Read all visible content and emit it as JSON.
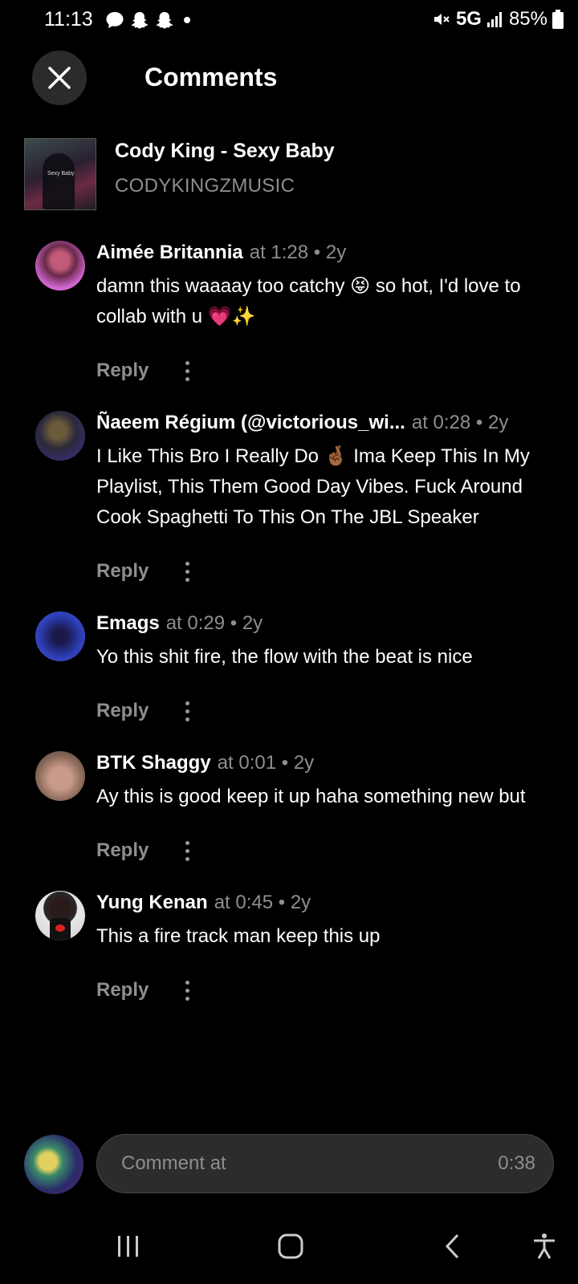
{
  "status_bar": {
    "time": "11:13",
    "network": "5G",
    "battery": "85%"
  },
  "header": {
    "title": "Comments"
  },
  "track": {
    "title": "Cody King - Sexy Baby",
    "artist": "CODYKINGZMUSIC",
    "cover_text": "Sexy Baby"
  },
  "comments": [
    {
      "name": "Aimée Britannia",
      "meta": "at 1:28 • 2y",
      "text": "damn this waaaay too catchy 😝 so hot, I'd love to collab with u 💗✨",
      "reply_label": "Reply"
    },
    {
      "name": "Ñaeem Régium (@victorious_wi...",
      "meta": "at 0:28 • 2y",
      "text": "I Like This Bro I Really Do 🤞🏾 Ima Keep This In My Playlist, This Them Good Day Vibes. Fuck Around Cook Spaghetti To This On The JBL Speaker",
      "reply_label": "Reply"
    },
    {
      "name": "Emags",
      "meta": "at 0:29 • 2y",
      "text": "Yo this shit fire, the flow with the beat is nice",
      "reply_label": "Reply"
    },
    {
      "name": "BTK Shaggy",
      "meta": "at 0:01 • 2y",
      "text": "Ay this is good keep it up haha something new but",
      "reply_label": "Reply"
    },
    {
      "name": "Yung Kenan",
      "meta": "at 0:45 • 2y",
      "text": "This a fire track man keep this up",
      "reply_label": "Reply"
    }
  ],
  "composer": {
    "placeholder": "Comment at",
    "timestamp": "0:38"
  },
  "icons": {
    "close": "close-icon",
    "more": "more-vertical-icon",
    "recents": "recents-icon",
    "home": "home-icon",
    "back": "back-icon",
    "accessibility": "accessibility-icon"
  },
  "colors": {
    "background": "#000000",
    "text": "#ffffff",
    "secondary_text": "#8e8e8e",
    "input_bg": "#2c2c2c"
  }
}
